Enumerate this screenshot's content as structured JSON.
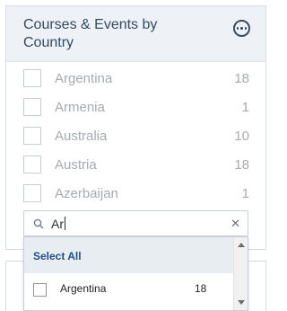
{
  "panel": {
    "title": "Courses & Events by Country",
    "countries": [
      {
        "name": "Argentina",
        "count": "18"
      },
      {
        "name": "Armenia",
        "count": "1"
      },
      {
        "name": "Australia",
        "count": "10"
      },
      {
        "name": "Austria",
        "count": "18"
      },
      {
        "name": "Azerbaijan",
        "count": "1"
      }
    ]
  },
  "search": {
    "value": "Ar",
    "icon": "search-icon",
    "clear_icon": "close-icon"
  },
  "dropdown": {
    "select_all_label": "Select All",
    "options": [
      {
        "name": "Argentina",
        "count": "18"
      }
    ]
  },
  "colors": {
    "header_bg": "#eef1f5",
    "accent": "#1f4e8c",
    "faded_text": "#a6abb1"
  }
}
